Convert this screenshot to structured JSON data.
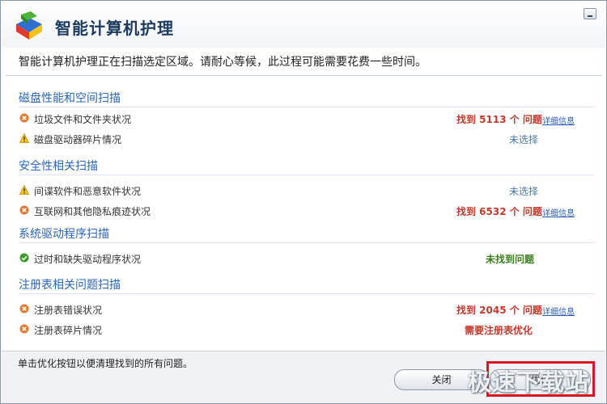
{
  "app": {
    "title": "智能计算机护理"
  },
  "intro": "智能计算机护理正在扫描选定区域。请耐心等候，此过程可能需要花费一些时间。",
  "sections": [
    {
      "title": "磁盘性能和空间扫描",
      "items": [
        {
          "label": "垃圾文件和文件夹状况",
          "status": "找到 5113 个 问题",
          "link": "详细信息",
          "icon": "error-x-icon"
        },
        {
          "label": "磁盘驱动器碎片情况",
          "status": "未选择",
          "icon": "warning-icon"
        }
      ]
    },
    {
      "title": "安全性相关扫描",
      "items": [
        {
          "label": "间谍软件和恶意软件状况",
          "status": "未选择",
          "icon": "warning-icon"
        },
        {
          "label": "互联网和其他隐私痕迹状况",
          "status": "找到 6532 个 问题",
          "link": "详细信息",
          "icon": "error-x-icon"
        }
      ]
    },
    {
      "title": "系统驱动程序扫描",
      "items": [
        {
          "label": "过时和缺失驱动程序状况",
          "status": "未找到问题",
          "icon": "check-icon"
        }
      ]
    },
    {
      "title": "注册表相关问题扫描",
      "items": [
        {
          "label": "注册表错误状况",
          "status": "找到 2045 个 问题",
          "link": "详细信息",
          "icon": "error-x-icon"
        },
        {
          "label": "注册表碎片情况",
          "status": "需要注册表优化",
          "icon": "error-x-icon"
        }
      ]
    }
  ],
  "footer": {
    "note": "单击优化按钮以便清理找到的所有问题。",
    "close_label": "关闭",
    "optimize_label": "优化"
  },
  "watermark": "极速下载站",
  "colors": {
    "problem": "#c0392b",
    "section": "#2a65b8",
    "good": "#3a7d1c",
    "highlight": "#e0141e"
  }
}
